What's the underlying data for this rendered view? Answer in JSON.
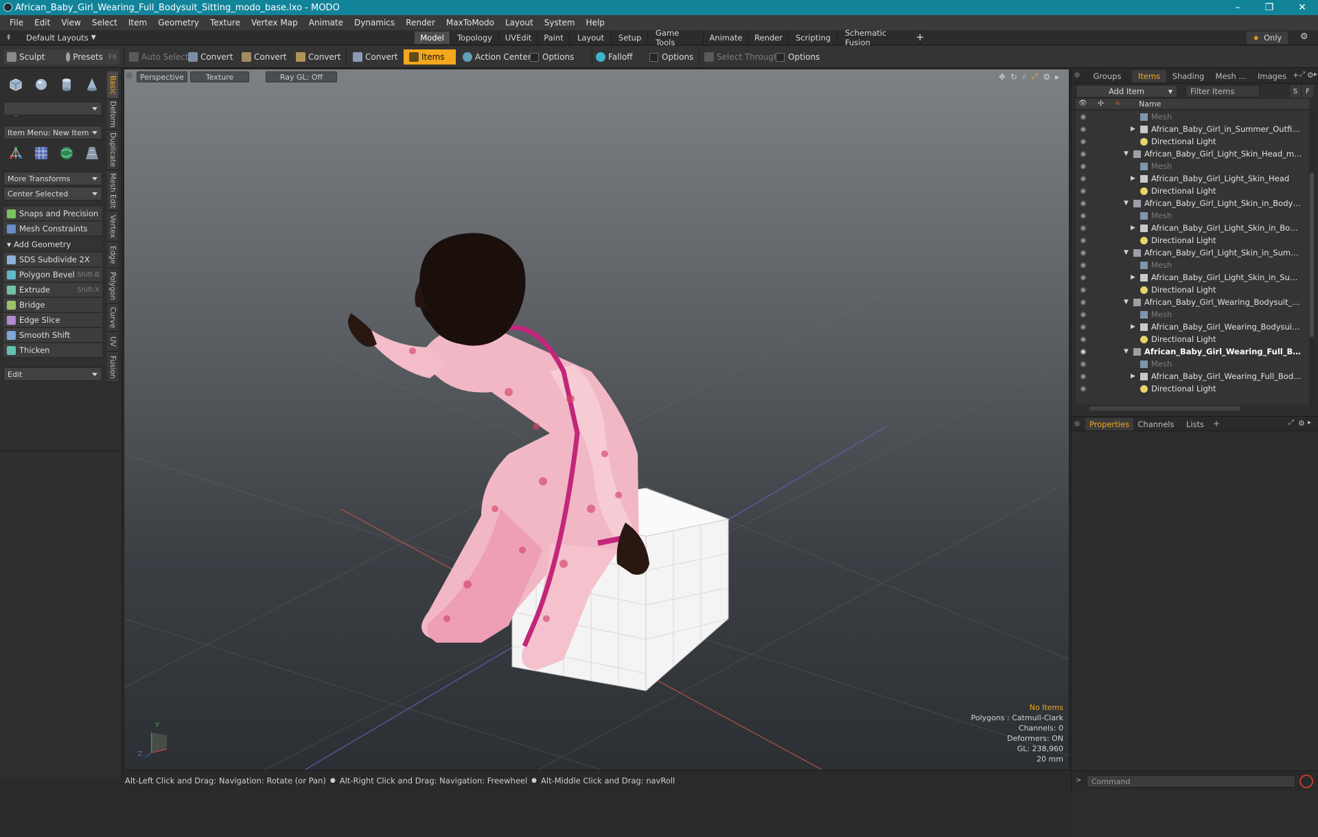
{
  "window": {
    "title": "African_Baby_Girl_Wearing_Full_Bodysuit_Sitting_modo_base.lxo - MODO",
    "minimize": "–",
    "maximize": "❐",
    "close": "✕"
  },
  "menu": [
    "File",
    "Edit",
    "View",
    "Select",
    "Item",
    "Geometry",
    "Texture",
    "Vertex Map",
    "Animate",
    "Dynamics",
    "Render",
    "MaxToModo",
    "Layout",
    "System",
    "Help"
  ],
  "layoutbar": {
    "layouts_label": "Default Layouts",
    "tabs": [
      "Model",
      "Topology",
      "UVEdit",
      "Paint",
      "Layout",
      "Setup",
      "Game Tools",
      "Animate",
      "Render",
      "Scripting",
      "Schematic Fusion"
    ],
    "active_tab": "Model",
    "add": "+",
    "only_label": "Only",
    "star": "★"
  },
  "toolbar": {
    "sculpt": "Sculpt",
    "presets": "Presets",
    "presets_shortcut": "F6",
    "auto_select": "Auto Select",
    "convert1": "Convert",
    "convert2": "Convert",
    "convert3": "Convert",
    "convert4": "Convert",
    "items": "Items",
    "action_center": "Action Center",
    "options1": "Options",
    "falloff": "Falloff",
    "options2": "Options",
    "select_through": "Select Through",
    "options3": "Options"
  },
  "leftpanel": {
    "item_menu": "Item Menu: New Item",
    "more_transforms": "More Transforms",
    "center_selected": "Center Selected",
    "snaps": "Snaps and Precision",
    "mesh_constraints": "Mesh Constraints",
    "add_geometry": "Add Geometry",
    "tools": [
      {
        "label": "SDS Subdivide 2X",
        "shortcut": ""
      },
      {
        "label": "Polygon Bevel",
        "shortcut": "Shift-B"
      },
      {
        "label": "Extrude",
        "shortcut": "Shift-X"
      },
      {
        "label": "Bridge",
        "shortcut": ""
      },
      {
        "label": "Edge Slice",
        "shortcut": ""
      },
      {
        "label": "Smooth Shift",
        "shortcut": ""
      },
      {
        "label": "Thicken",
        "shortcut": ""
      }
    ],
    "edit": "Edit",
    "vtabs": [
      "Basic",
      "Deform",
      "Duplicate",
      "Mesh Edit",
      "Vertex",
      "Edge",
      "Polygon",
      "Curve",
      "UV",
      "Fusion"
    ]
  },
  "viewport": {
    "tabs": [
      "Perspective",
      "Texture",
      "Ray GL: Off"
    ],
    "info": {
      "selection": "No Items",
      "polygons": "Polygons : Catmull-Clark",
      "channels": "Channels: 0",
      "deformers": "Deformers: ON",
      "gl": "GL: 238,960",
      "scale": "20 mm"
    },
    "axis_y": "Y",
    "axis_z": "Z"
  },
  "statusbar": {
    "hint1": "Alt-Left Click and Drag: Navigation: Rotate (or Pan)",
    "hint2": "Alt-Right Click and Drag: Navigation: Freewheel",
    "hint3": "Alt-Middle Click and Drag: navRoll"
  },
  "rightpanel": {
    "tabs": [
      "Groups",
      "Items",
      "Shading",
      "Mesh ...",
      "Images"
    ],
    "active_tab": "Items",
    "add_item": "Add Item",
    "filter_items": "Filter Items",
    "s": "S",
    "f": "F",
    "name_header": "Name",
    "tree": [
      {
        "label": "Mesh",
        "level": 2,
        "kind": "mesh",
        "dim": true
      },
      {
        "label": "African_Baby_Girl_in_Summer_Outfit_Su...",
        "level": 2,
        "kind": "group",
        "arrow": "▶"
      },
      {
        "label": "Directional Light",
        "level": 2,
        "kind": "light"
      },
      {
        "label": "African_Baby_Girl_Light_Skin_Head_modo ...",
        "level": 1,
        "kind": "scene",
        "arrow": "▼"
      },
      {
        "label": "Mesh",
        "level": 2,
        "kind": "mesh",
        "dim": true
      },
      {
        "label": "African_Baby_Girl_Light_Skin_Head",
        "level": 2,
        "kind": "group",
        "arrow": "▶"
      },
      {
        "label": "Directional Light",
        "level": 2,
        "kind": "light"
      },
      {
        "label": "African_Baby_Girl_Light_Skin_in_Bodysuit_...",
        "level": 1,
        "kind": "scene",
        "arrow": "▼"
      },
      {
        "label": "Mesh",
        "level": 2,
        "kind": "mesh",
        "dim": true
      },
      {
        "label": "African_Baby_Girl_Light_Skin_in_Bodysu...",
        "level": 2,
        "kind": "group",
        "arrow": "▶"
      },
      {
        "label": "Directional Light",
        "level": 2,
        "kind": "light"
      },
      {
        "label": "African_Baby_Girl_Light_Skin_in_Summer_ ...",
        "level": 1,
        "kind": "scene",
        "arrow": "▼"
      },
      {
        "label": "Mesh",
        "level": 2,
        "kind": "mesh",
        "dim": true
      },
      {
        "label": "African_Baby_Girl_Light_Skin_in_Summe ...",
        "level": 2,
        "kind": "group",
        "arrow": "▶"
      },
      {
        "label": "Directional Light",
        "level": 2,
        "kind": "light"
      },
      {
        "label": "African_Baby_Girl_Wearing_Bodysuit_Sitti ...",
        "level": 1,
        "kind": "scene",
        "arrow": "▼"
      },
      {
        "label": "Mesh",
        "level": 2,
        "kind": "mesh",
        "dim": true
      },
      {
        "label": "African_Baby_Girl_Wearing_Bodysuit_Si ...",
        "level": 2,
        "kind": "group",
        "arrow": "▶"
      },
      {
        "label": "Directional Light",
        "level": 2,
        "kind": "light"
      },
      {
        "label": "African_Baby_Girl_Wearing_Full_Bo ...",
        "level": 1,
        "kind": "scene",
        "arrow": "▼",
        "bold": true
      },
      {
        "label": "Mesh",
        "level": 2,
        "kind": "mesh",
        "dim": true
      },
      {
        "label": "African_Baby_Girl_Wearing_Full_Bodysu...",
        "level": 2,
        "kind": "group",
        "arrow": "▶"
      },
      {
        "label": "Directional Light",
        "level": 2,
        "kind": "light"
      }
    ],
    "props_tabs": [
      "Properties",
      "Channels",
      "Lists"
    ],
    "props_active": "Properties",
    "props_add": "+",
    "command_placeholder": "Command"
  },
  "colors": {
    "accent": "#f4a81d",
    "titlebar": "#12849a"
  }
}
